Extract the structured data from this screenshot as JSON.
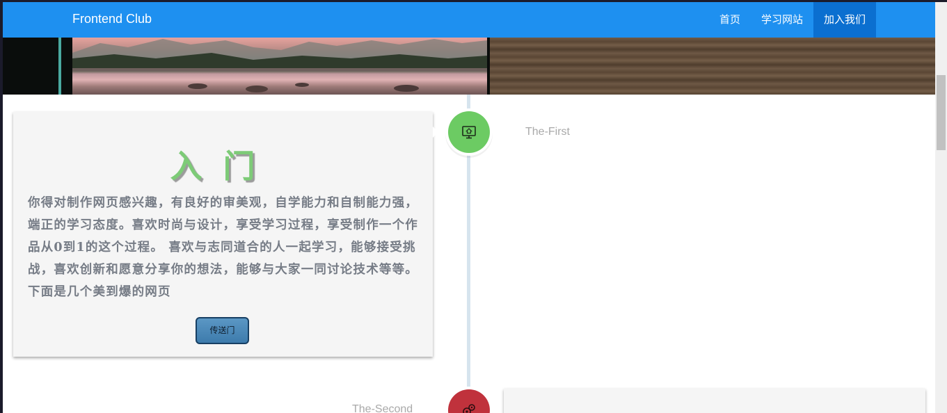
{
  "navbar": {
    "brand": "Frontend Club",
    "items": [
      {
        "label": "首页",
        "active": false
      },
      {
        "label": "学习网站",
        "active": false
      },
      {
        "label": "加入我们",
        "active": true
      }
    ],
    "color": "#1e90f0",
    "active_color": "#0b6fd0"
  },
  "timeline": {
    "steps": [
      {
        "label": "The-First",
        "icon": "monitor-home-icon",
        "color": "#6ccb63",
        "card": {
          "title": "入门",
          "body": "你得对制作网页感兴趣，有良好的审美观，自学能力和自制能力强，端正的学习态度。喜欢时尚与设计，享受学习过程，享受制作一个作品从0到1的这个过程。 喜欢与志同道合的人一起学习，能够接受挑战，喜欢创新和愿意分享你的想法，能够与大家一同讨论技术等等。下面是几个美到爆的网页",
          "button": "传送门"
        }
      },
      {
        "label": "The-Second",
        "icon": "gears-icon",
        "color": "#c0323c"
      }
    ]
  }
}
